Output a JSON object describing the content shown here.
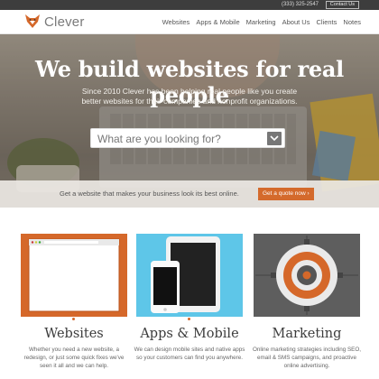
{
  "topbar": {
    "phone": "(333) 325-2547",
    "contact": "Contact Us"
  },
  "brand": {
    "name": "Clever",
    "accent": "#d5682a"
  },
  "nav": {
    "items": [
      "Websites",
      "Apps & Mobile",
      "Marketing",
      "About Us",
      "Clients",
      "Notes"
    ]
  },
  "hero": {
    "title": "We build websites for real people",
    "subtitle": "Since 2010 Clever has been helping real people like you create better websites for their companies and nonprofit organizations.",
    "search_placeholder": "What are you looking for?"
  },
  "cta": {
    "message": "Get a website that makes your business look its best online.",
    "button": "Get a quote now ›"
  },
  "services": [
    {
      "title": "Websites",
      "desc": "Whether you need a new website, a redesign, or just some quick fixes we've seen it all and we can help.",
      "icon": "browser-window-icon",
      "color": "#d5682a"
    },
    {
      "title": "Apps & Mobile",
      "desc": "We can design mobile sites and native apps so your customers can find you anywhere.",
      "icon": "tablet-phone-icon",
      "color": "#5ec6e8"
    },
    {
      "title": "Marketing",
      "desc": "Online marketing strategies including SEO, email & SMS campaigns, and proactive online advertising.",
      "icon": "target-icon",
      "color": "#5e5e5e"
    }
  ]
}
